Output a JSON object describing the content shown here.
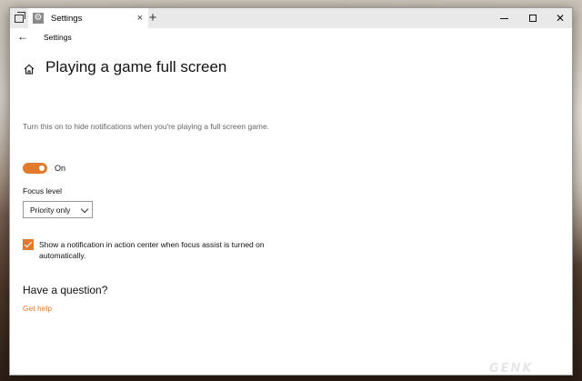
{
  "window": {
    "tab_title": "Settings",
    "tab_close": "×",
    "tab_add": "+",
    "close_glyph": "✕"
  },
  "nav": {
    "back_glyph": "←",
    "title": "Settings"
  },
  "page": {
    "title": "Playing a game full screen",
    "description": "Turn this on to hide notifications when you're playing a full screen game.",
    "toggle": {
      "state": "on",
      "label": "On"
    },
    "focus_level": {
      "label": "Focus level",
      "selected": "Priority only"
    },
    "notification_checkbox": {
      "checked": true,
      "label": "Show a notification in action center when focus assist is turned on automatically."
    },
    "question_heading": "Have a question?",
    "help_link": "Get help"
  },
  "colors": {
    "accent": "#e07b2e"
  },
  "icons": {
    "tab": "gear-icon",
    "home": "home-icon",
    "back": "back-arrow-icon"
  },
  "watermark": "GENK"
}
